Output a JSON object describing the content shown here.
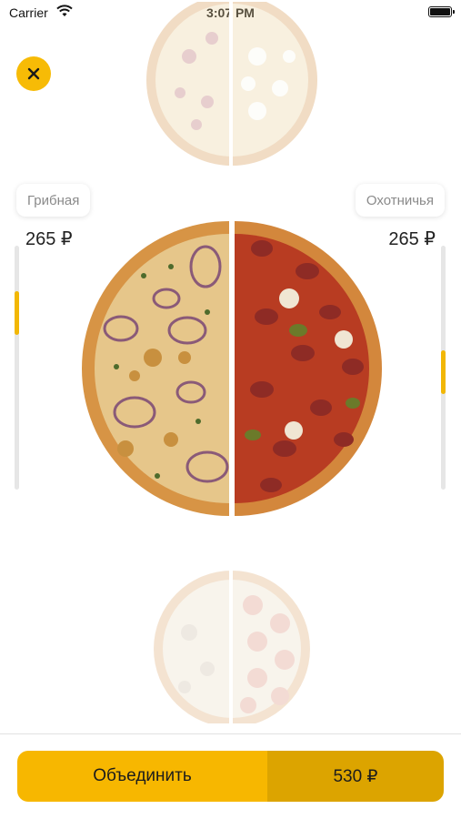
{
  "status_bar": {
    "carrier": "Carrier",
    "time": "3:07 PM"
  },
  "close_button": {
    "icon": "close-icon"
  },
  "left_half": {
    "name": "Грибная",
    "price": "265 ₽",
    "scroll_position": 0.15,
    "colors": {
      "crust": "#d79445",
      "cheese": "#e9cf8e",
      "accent": "#8a5a78"
    }
  },
  "right_half": {
    "name": "Охотничья",
    "price": "265 ₽",
    "scroll_position": 0.5,
    "colors": {
      "crust": "#d3873c",
      "sauce": "#b83c22",
      "sausage": "#a8312a"
    }
  },
  "action": {
    "label": "Объединить",
    "total": "530 ₽"
  },
  "colors": {
    "accent": "#f7b700",
    "accent_dark": "#dca400",
    "track": "#e6e6e6"
  }
}
